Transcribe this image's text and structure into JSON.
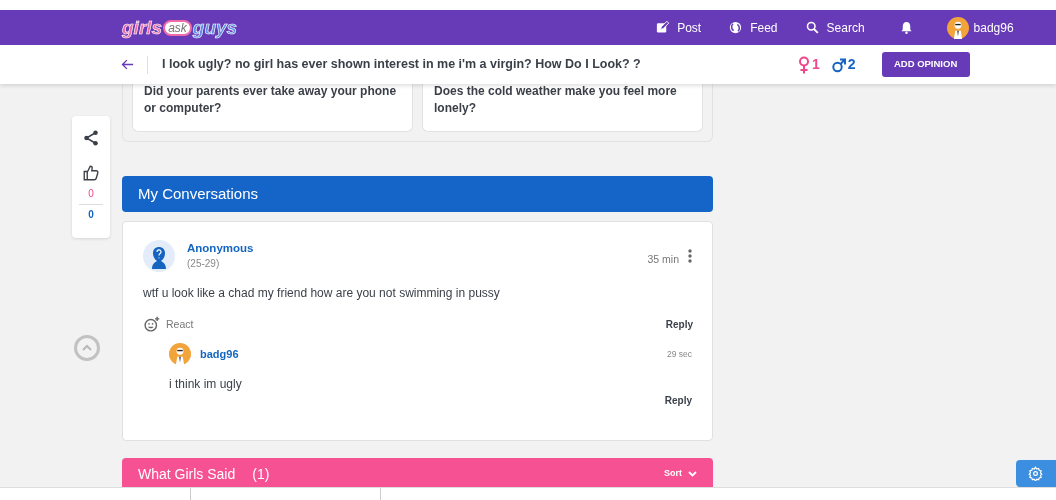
{
  "logo": {
    "parts": [
      "girls",
      "ask",
      "guys"
    ]
  },
  "nav": {
    "items": [
      {
        "kind": "post",
        "label": "Post"
      },
      {
        "kind": "feed",
        "label": "Feed"
      },
      {
        "kind": "search",
        "label": "Search"
      },
      {
        "kind": "bell"
      }
    ],
    "user": {
      "name": "badg96"
    }
  },
  "question": {
    "title": "I look ugly? no girl has ever shown interest in me i'm a virgin? How Do I Look? ?",
    "girls_count": "1",
    "guys_count": "2",
    "button": "ADD OPINION"
  },
  "related_questions": [
    "Did your parents ever take away your phone or computer?",
    "Does the cold weather make you feel more lonely?"
  ],
  "side_panel": {
    "girls_likes": "0",
    "guys_likes": "0"
  },
  "conversations": {
    "title": "My Conversations",
    "comments": [
      {
        "kind": "anonymous",
        "author": "Anonymous",
        "age": "(25-29)",
        "time": "35 min",
        "text": "wtf u look like a chad my friend how are you not swimming in pussy",
        "react": "React",
        "reply": "Reply",
        "replies": [
          {
            "kind": "user",
            "author": "badg96",
            "time": "29 sec",
            "text": "i think im ugly",
            "reply": "Reply"
          }
        ]
      }
    ]
  },
  "girls_section": {
    "title": "What Girls Said",
    "count": "(1)",
    "sort": "Sort"
  }
}
